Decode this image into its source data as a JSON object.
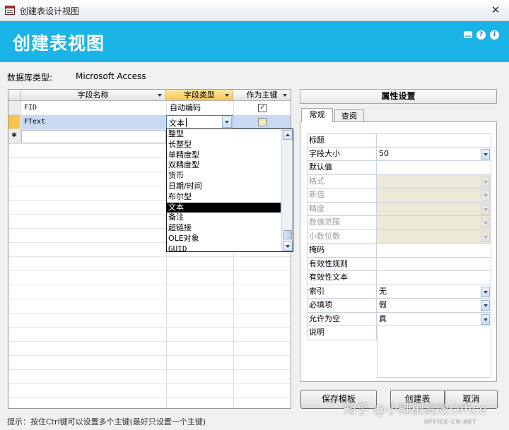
{
  "window": {
    "title": "创建表设计视图",
    "close_symbol": "✕"
  },
  "banner": {
    "heading": "创建表视图",
    "icons": [
      "comment-icon",
      "help-icon",
      "info-icon"
    ]
  },
  "db_type": {
    "label": "数据库类型:",
    "value": "Microsoft Access"
  },
  "grid": {
    "columns": [
      "字段名称",
      "字段类型",
      "作为主键"
    ],
    "rows": [
      {
        "name": "FID",
        "type": "自动编码",
        "primary_key": true
      },
      {
        "name": "FText",
        "type": "文本",
        "primary_key": false
      }
    ],
    "new_row_marker": "*"
  },
  "type_dropdown": {
    "current_value": "文本",
    "options": [
      "整型",
      "长整型",
      "单精度型",
      "双精度型",
      "货币",
      "日期/时间",
      "布尔型",
      "文本",
      "备注",
      "超链接",
      "OLE对象",
      "GUID"
    ],
    "highlighted": "文本"
  },
  "properties": {
    "header": "属性设置",
    "tabs": [
      "常规",
      "查阅"
    ],
    "active_tab": "常规",
    "rows": [
      {
        "name": "标题",
        "value": "",
        "disabled": false,
        "dropdown": false
      },
      {
        "name": "字段大小",
        "value": "50",
        "disabled": false,
        "dropdown": true
      },
      {
        "name": "默认值",
        "value": "",
        "disabled": false,
        "dropdown": false
      },
      {
        "name": "格式",
        "value": "",
        "disabled": true,
        "dropdown": true
      },
      {
        "name": "新值",
        "value": "",
        "disabled": true,
        "dropdown": true
      },
      {
        "name": "精度",
        "value": "",
        "disabled": true,
        "dropdown": true
      },
      {
        "name": "数值范围",
        "value": "",
        "disabled": true,
        "dropdown": true
      },
      {
        "name": "小数位数",
        "value": "",
        "disabled": true,
        "dropdown": true
      },
      {
        "name": "掩码",
        "value": "",
        "disabled": false,
        "dropdown": false
      },
      {
        "name": "有效性规则",
        "value": "",
        "disabled": false,
        "dropdown": false
      },
      {
        "name": "有效性文本",
        "value": "",
        "disabled": false,
        "dropdown": false
      },
      {
        "name": "索引",
        "value": "无",
        "disabled": false,
        "dropdown": true
      },
      {
        "name": "必填项",
        "value": "假",
        "disabled": false,
        "dropdown": true
      },
      {
        "name": "允许为空",
        "value": "真",
        "disabled": false,
        "dropdown": true
      },
      {
        "name": "说明",
        "value": "",
        "disabled": false,
        "dropdown": false
      }
    ]
  },
  "buttons": {
    "save_template": "保存模板",
    "create_table": "创建表",
    "cancel": "取消"
  },
  "status_hint": "提示：按住Ctrl键可以设置多个主键(最好只设置一个主键)",
  "watermark": {
    "text": "知乎 @小辣椒高效Office",
    "site": "OFFICE-CN.NET"
  }
}
